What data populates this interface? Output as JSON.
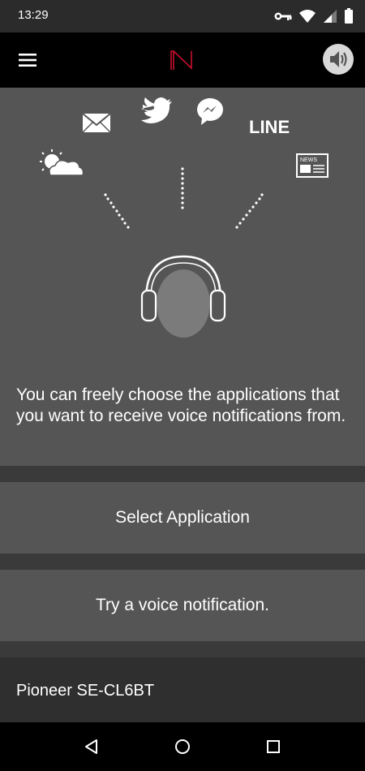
{
  "status_bar": {
    "time": "13:29",
    "icons": [
      "vpn-key-icon",
      "wifi-icon",
      "signal-icon",
      "battery-icon"
    ]
  },
  "app_bar": {
    "menu_icon": "hamburger-menu-icon",
    "logo": "N",
    "speaker_icon": "speaker-icon",
    "accent_color": "#c8102e"
  },
  "hero": {
    "app_icons": [
      "mail-icon",
      "twitter-icon",
      "messenger-icon",
      "weather-icon",
      "news-icon"
    ],
    "line_label": "LINE",
    "news_label": "NEWS",
    "description": "You can freely choose the applications that you want to receive voice notifications from."
  },
  "actions": {
    "select_application": "Select Application",
    "try_voice_notification": "Try a voice notification."
  },
  "device": {
    "name": "Pioneer SE-CL6BT"
  },
  "nav_bar": {
    "icons": [
      "back-icon",
      "home-icon",
      "recents-icon"
    ]
  }
}
